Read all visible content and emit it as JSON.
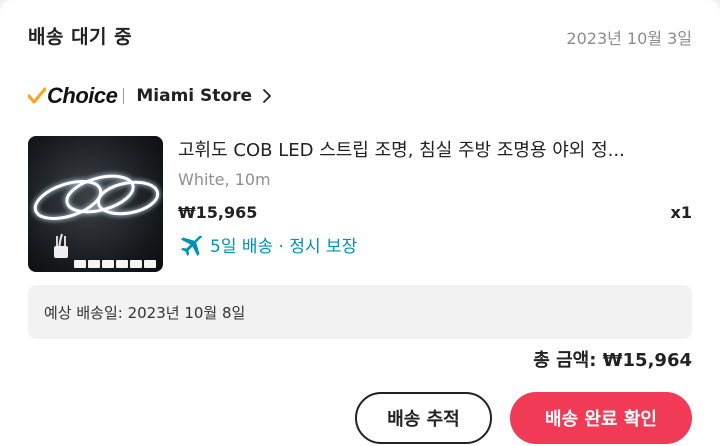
{
  "order": {
    "status": "배송 대기 중",
    "date": "2023년 10월 3일"
  },
  "store": {
    "badge": "Choice",
    "name": "Miami Store"
  },
  "product": {
    "title": "고휘도 COB LED 스트립 조명, 침실 주방 조명용 야외 정...",
    "variant": "White, 10m",
    "price": "₩15,965",
    "quantity": "x1",
    "shipping": "5일 배송 · 정시 보장"
  },
  "eta": {
    "text": "예상 배송일: 2023년 10월 8일"
  },
  "total": {
    "text": "총 금액: ₩15,964"
  },
  "actions": {
    "track_label": "배송 추적",
    "confirm_label": "배송 완료 확인"
  },
  "colors": {
    "accent": "#f03a56",
    "shipping": "#0091b3",
    "choice_check": "#f5a623"
  },
  "icons": [
    "checkmark-icon",
    "chevron-right-icon",
    "airplane-icon"
  ]
}
